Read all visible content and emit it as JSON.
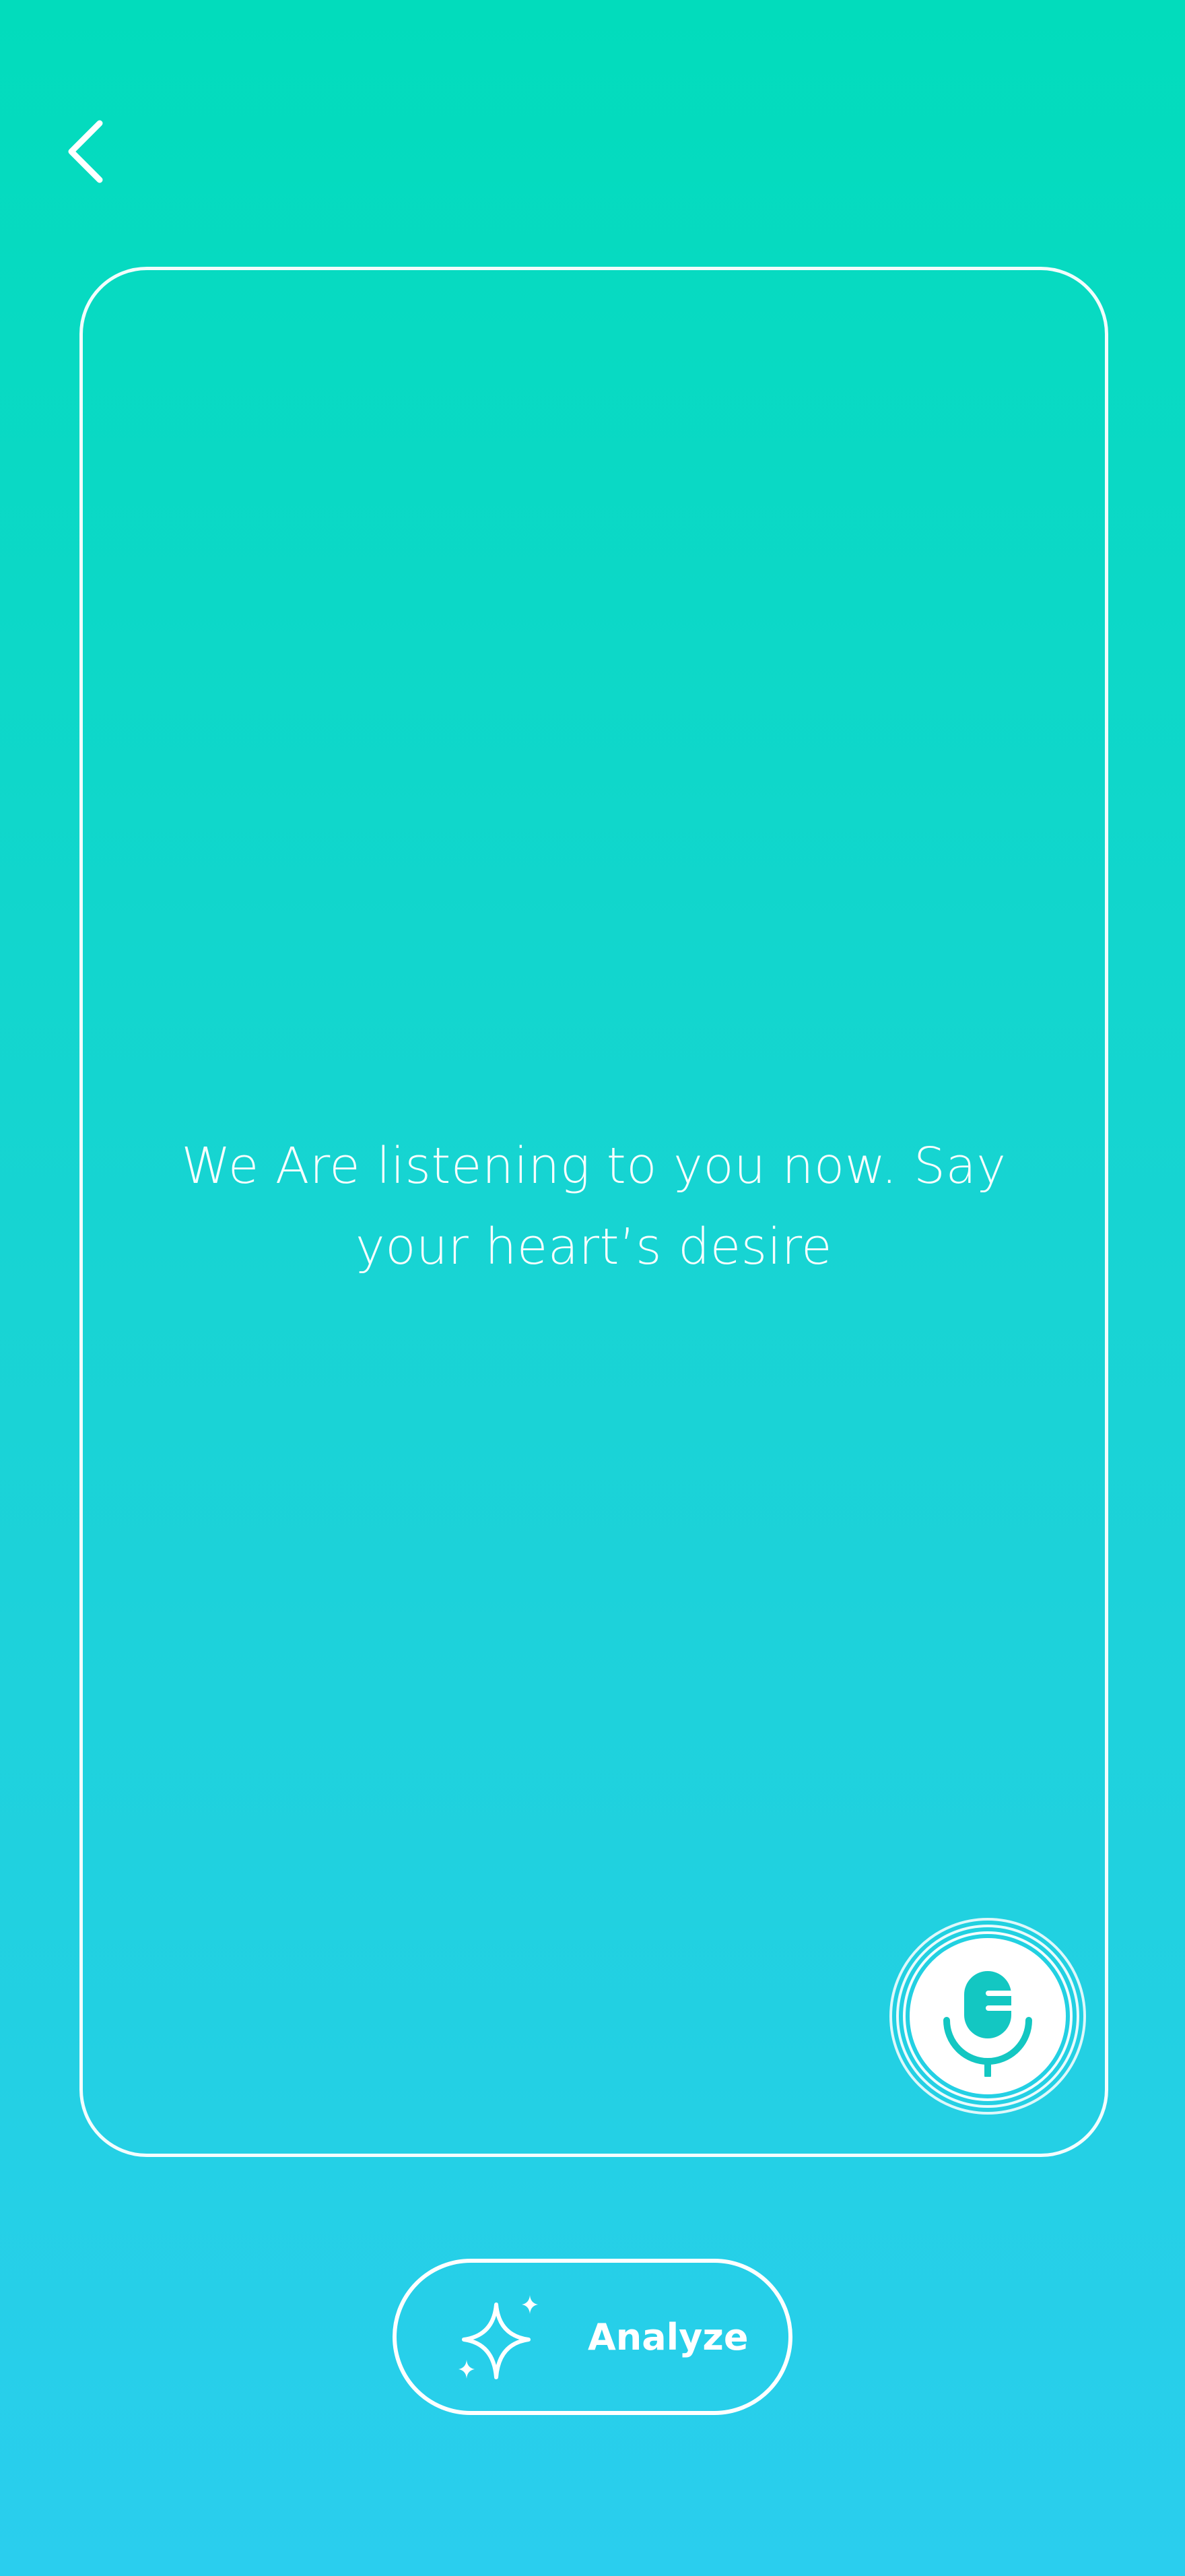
{
  "header": {
    "back_icon": "chevron-left-icon"
  },
  "card": {
    "prompt": "We Are listening to you now. Say your heart’s desire"
  },
  "mic": {
    "icon": "microphone-icon",
    "accent_color": "#13C7C2"
  },
  "actions": {
    "analyze_label": "Analyze",
    "analyze_icon": "sparkle-icon"
  },
  "colors": {
    "gradient_top": "#02DCBC",
    "gradient_bottom": "#2ACEEE",
    "foreground": "#FFFFFF"
  }
}
